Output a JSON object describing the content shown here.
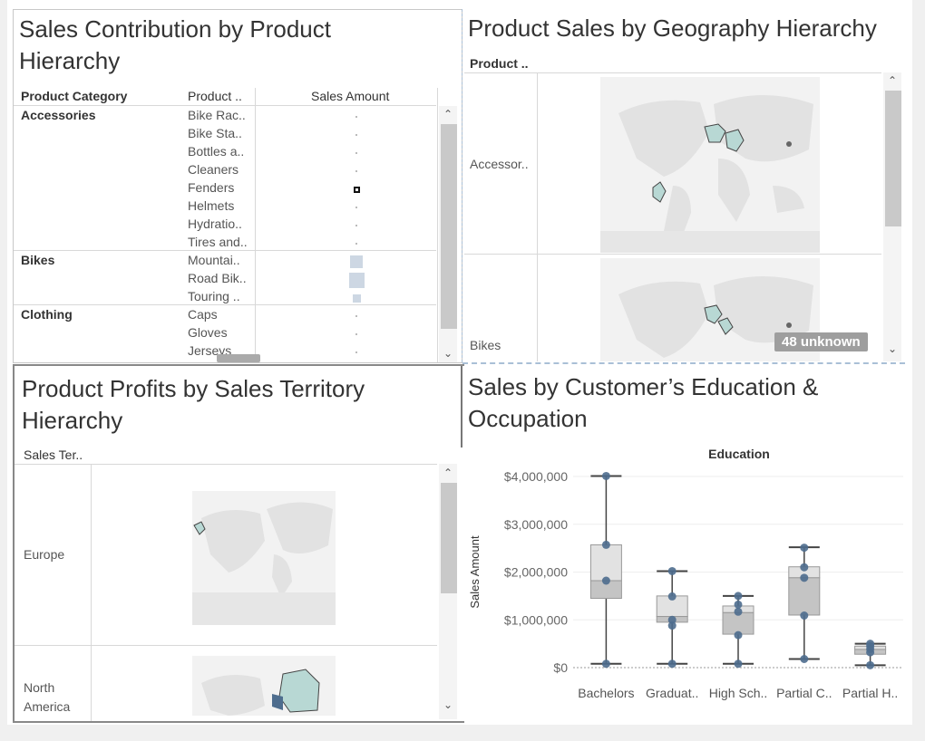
{
  "pane1": {
    "title_line1": "Sales Contribution by Product",
    "title_line2": "Hierarchy",
    "headers": [
      "Product Category",
      "Product ..",
      "Sales Amount"
    ],
    "groups": [
      {
        "category": "Accessories",
        "items": [
          "Bike Rac..",
          "Bike Sta..",
          "Bottles a..",
          "Cleaners",
          "Fenders",
          "Helmets",
          "Hydratio..",
          "Tires and.."
        ]
      },
      {
        "category": "Bikes",
        "items": [
          "Mountai..",
          "Road Bik..",
          "Touring .."
        ]
      },
      {
        "category": "Clothing",
        "items": [
          "Caps",
          "Gloves",
          "Jerseys"
        ]
      }
    ]
  },
  "pane2": {
    "title": "Product Sales by Geography Hierarchy",
    "header": "Product ..",
    "rows": [
      "Accessor..",
      "Bikes"
    ],
    "unknown_badge": "48 unknown"
  },
  "pane3": {
    "title_line1": "Product Profits by Sales Territory",
    "title_line2": "Hierarchy",
    "header": "Sales Ter..",
    "rows": [
      "Europe",
      "North",
      "America"
    ]
  },
  "pane4": {
    "title_line1": "Sales by Customer’s Education &",
    "title_line2": "Occupation"
  },
  "toolbar": {
    "close_glyph": "✕",
    "expand_glyph": "↗",
    "filter_glyph": "⊽",
    "more_glyph": "▾"
  },
  "chart_data": {
    "type": "boxplot",
    "title": "Education",
    "ylabel": "Sales Amount",
    "xlabel": "",
    "ylim": [
      0,
      4000000
    ],
    "yticks": [
      0,
      1000000,
      2000000,
      3000000,
      4000000
    ],
    "ytick_labels": [
      "$0",
      "$1,000,000",
      "$2,000,000",
      "$3,000,000",
      "$4,000,000"
    ],
    "categories": [
      "Bachelors",
      "Graduat..",
      "High Sch..",
      "Partial C..",
      "Partial H.."
    ],
    "boxes": [
      {
        "min": 80000,
        "q1": 1450000,
        "median": 1820000,
        "q3": 2570000,
        "max": 4010000,
        "points": [
          80000,
          1820000,
          2570000,
          4010000
        ]
      },
      {
        "min": 80000,
        "q1": 950000,
        "median": 1070000,
        "q3": 1500000,
        "max": 2020000,
        "points": [
          80000,
          880000,
          1000000,
          1490000,
          2020000
        ]
      },
      {
        "min": 80000,
        "q1": 700000,
        "median": 1150000,
        "q3": 1290000,
        "max": 1500000,
        "points": [
          80000,
          680000,
          1170000,
          1320000,
          1500000
        ]
      },
      {
        "min": 180000,
        "q1": 1100000,
        "median": 1880000,
        "q3": 2110000,
        "max": 2520000,
        "points": [
          180000,
          1090000,
          1880000,
          2100000,
          2510000
        ]
      },
      {
        "min": 50000,
        "q1": 280000,
        "median": 380000,
        "q3": 450000,
        "max": 500000,
        "points": [
          50000,
          320000,
          390000,
          450000,
          500000
        ]
      }
    ],
    "colors": {
      "box": "#d4d4d4",
      "whisker": "#444444",
      "point": "#4e6d8e",
      "grid": "#eeeeee"
    }
  },
  "bars": {
    "accessories_values": [
      0.02,
      0.02,
      0.02,
      0.02,
      0.6,
      0.02,
      0.02,
      0.02
    ],
    "bikes_values": [
      0.85,
      1.0,
      0.5
    ],
    "clothing_values": [
      0.02,
      0.02,
      0.02
    ]
  }
}
